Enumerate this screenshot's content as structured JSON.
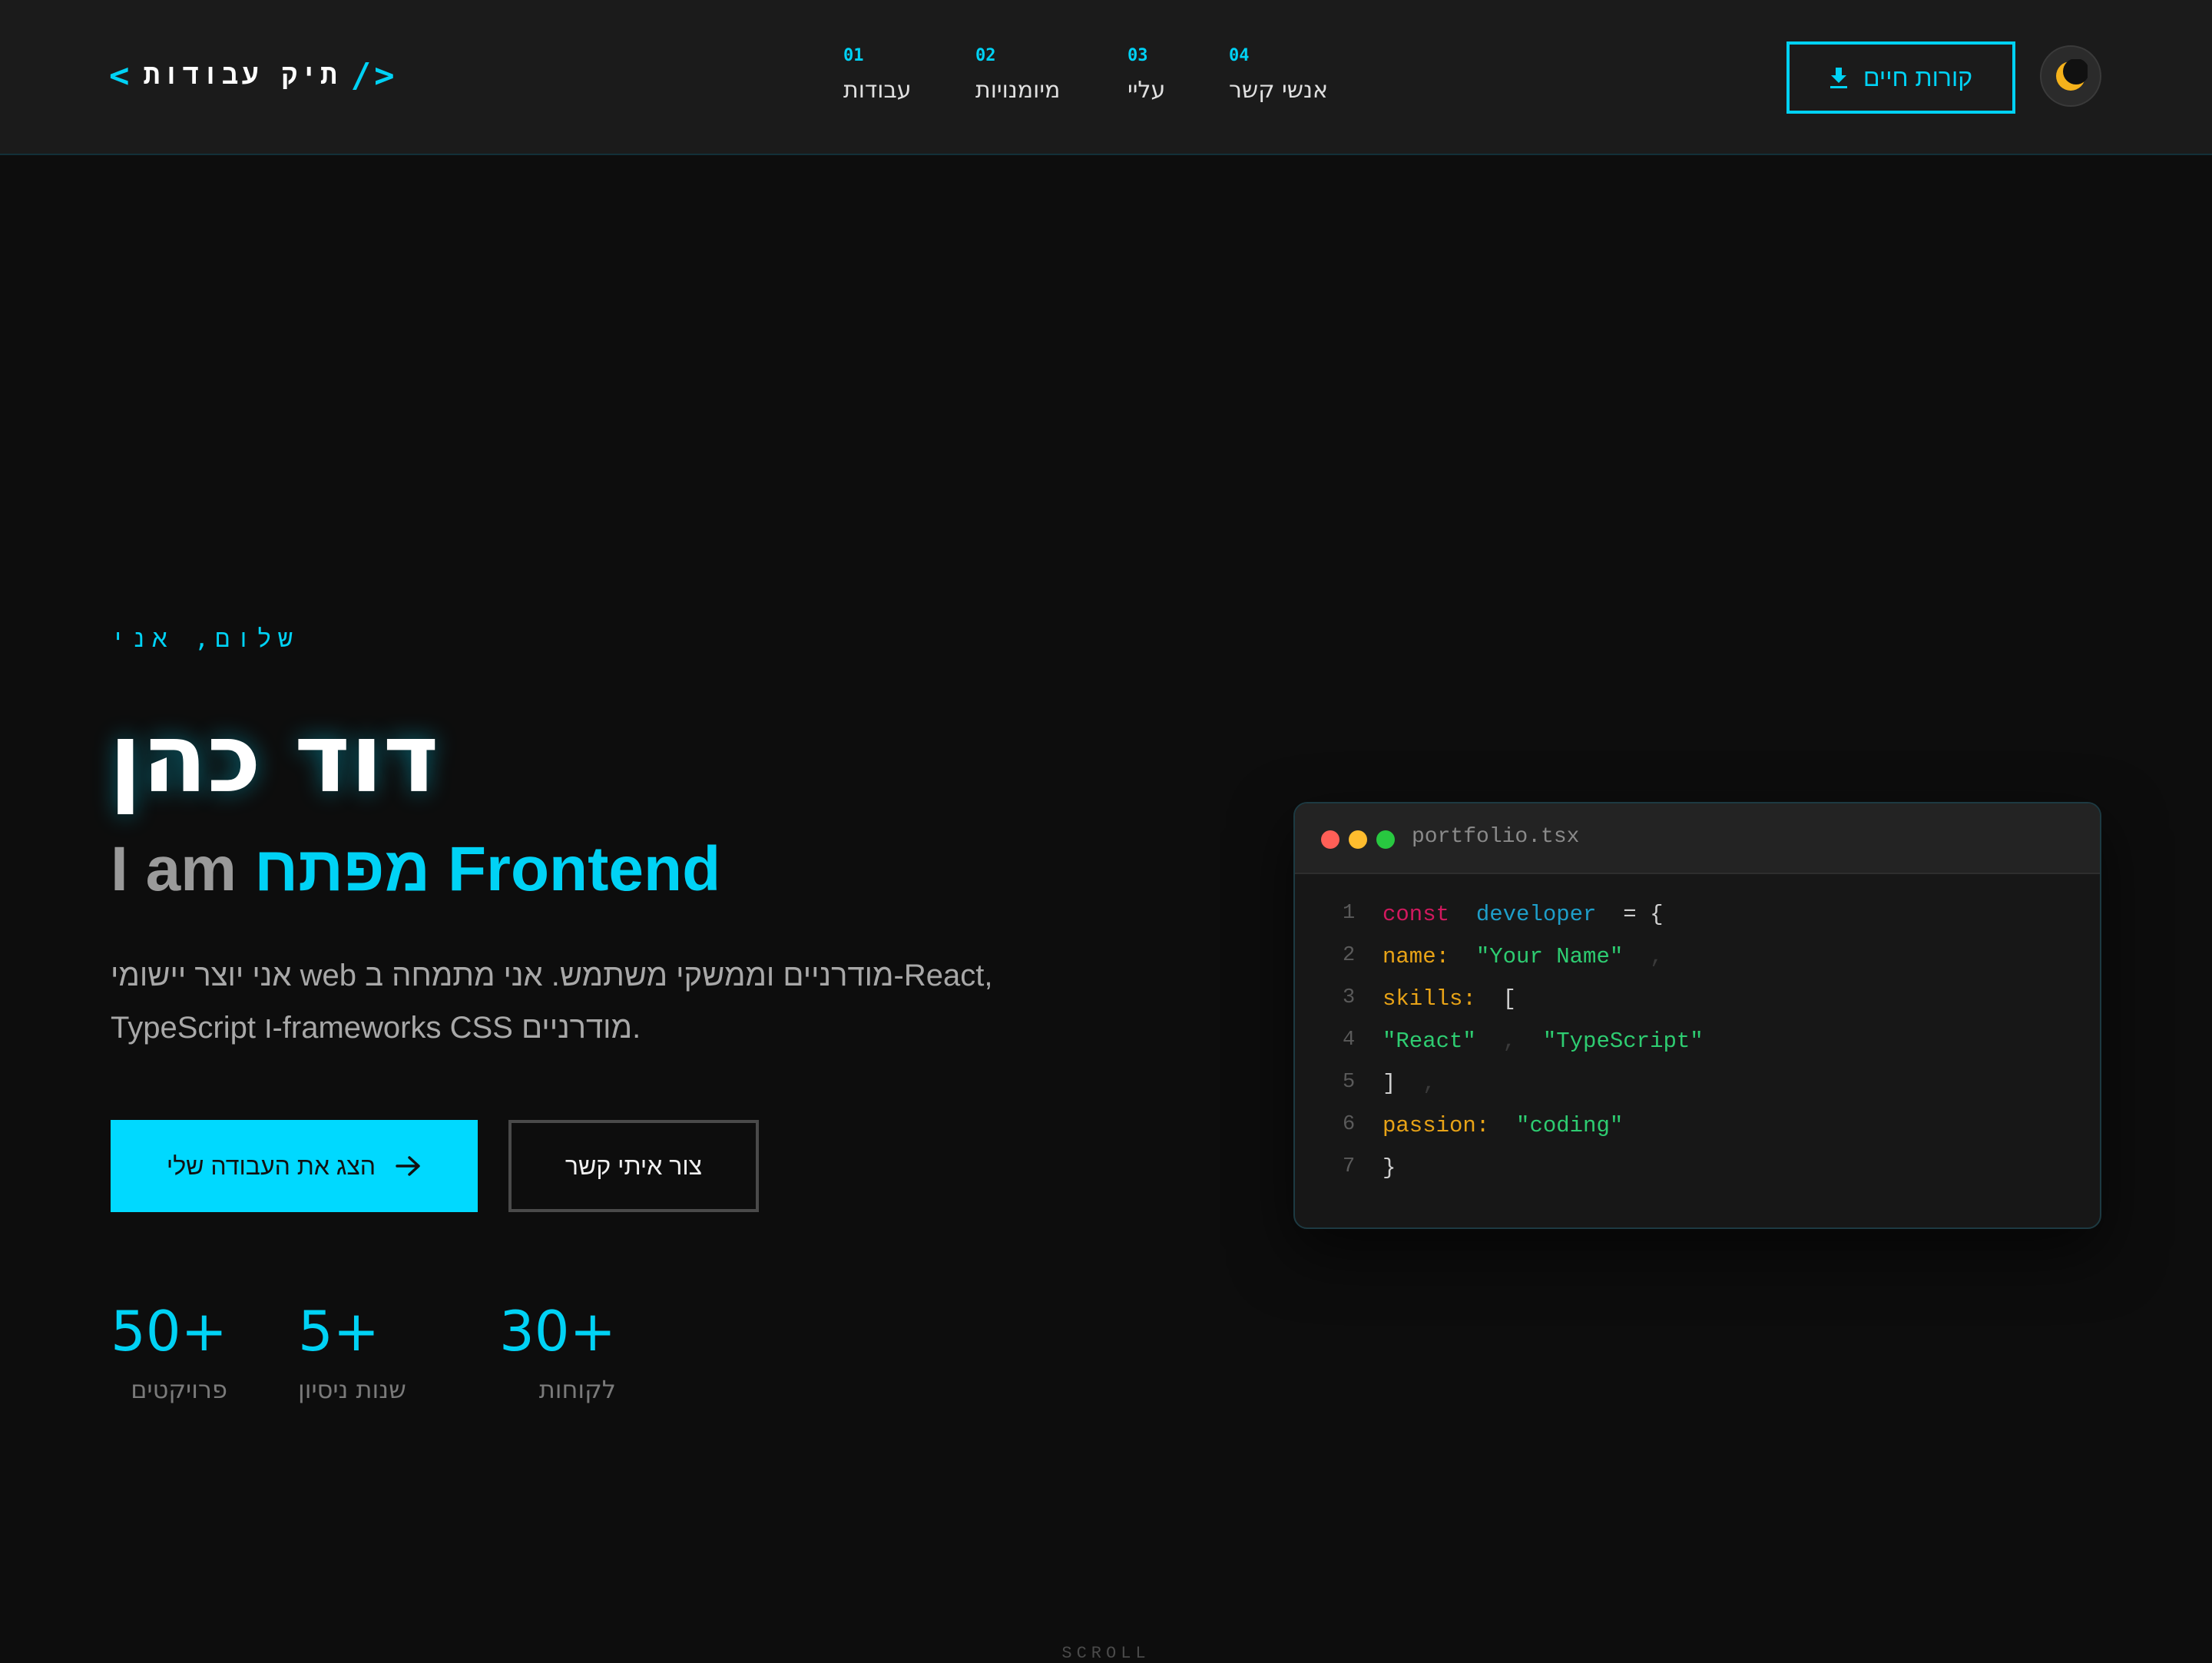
{
  "header": {
    "logo": {
      "bracket_left": "<",
      "text": "תיק עבודות",
      "bracket_right": "/>"
    },
    "nav": [
      {
        "num": "01",
        "label": "עבודות"
      },
      {
        "num": "02",
        "label": "מיומנויות"
      },
      {
        "num": "03",
        "label": "עליי"
      },
      {
        "num": "04",
        "label": "אנשי קשר"
      }
    ],
    "cv_button_label": "קורות חיים"
  },
  "hero": {
    "greeting": "שלום, אני",
    "name": "דוד כהן",
    "role_prefix": "I am",
    "role_accent": "מפתח Frontend",
    "description_lines": [
      "אני יוצר יישומי web מודרניים וממשקי משתמש. אני מתמחה ב-React,",
      "TypeScript ו-frameworks CSS מודרניים."
    ],
    "primary_button": "הצג את העבודה שלי",
    "secondary_button": "צור איתי קשר"
  },
  "stats": [
    {
      "value": "50+",
      "label": "פרויקטים"
    },
    {
      "value": "5+",
      "label": "שנות ניסיון"
    },
    {
      "value": "30+",
      "label": "לקוחות"
    }
  ],
  "code_window": {
    "filename": "portfolio.tsx",
    "lines": [
      {
        "n": "1",
        "tokens": [
          [
            "kw",
            "const"
          ],
          [
            "pun",
            "  "
          ],
          [
            "var",
            "developer"
          ],
          [
            "pun",
            "  = {"
          ]
        ]
      },
      {
        "n": "2",
        "tokens": [
          [
            "prop",
            "name:"
          ],
          [
            "pun",
            "  "
          ],
          [
            "str",
            "\"Your Name\""
          ],
          [
            "faint",
            "  ,"
          ]
        ]
      },
      {
        "n": "3",
        "tokens": [
          [
            "prop",
            "skills:"
          ],
          [
            "pun",
            "  ["
          ]
        ]
      },
      {
        "n": "4",
        "tokens": [
          [
            "str",
            "\"React\""
          ],
          [
            "faint",
            "  ,  "
          ],
          [
            "str",
            "\"TypeScript\""
          ]
        ]
      },
      {
        "n": "5",
        "tokens": [
          [
            "pun",
            "]"
          ],
          [
            "faint",
            "  ,"
          ]
        ]
      },
      {
        "n": "6",
        "tokens": [
          [
            "prop",
            "passion:"
          ],
          [
            "pun",
            "  "
          ],
          [
            "str",
            "\"coding\""
          ]
        ]
      },
      {
        "n": "7",
        "tokens": [
          [
            "pun",
            "}"
          ]
        ]
      }
    ]
  },
  "scroll_hint": "SCROLL",
  "colors": {
    "accent": "#00d2f5",
    "background": "#0d0d0d",
    "header_bg": "#1b1b1b"
  },
  "icons": {
    "cv_button": "download-icon",
    "theme_toggle": "moon-icon",
    "primary_button": "arrow-right-icon"
  }
}
